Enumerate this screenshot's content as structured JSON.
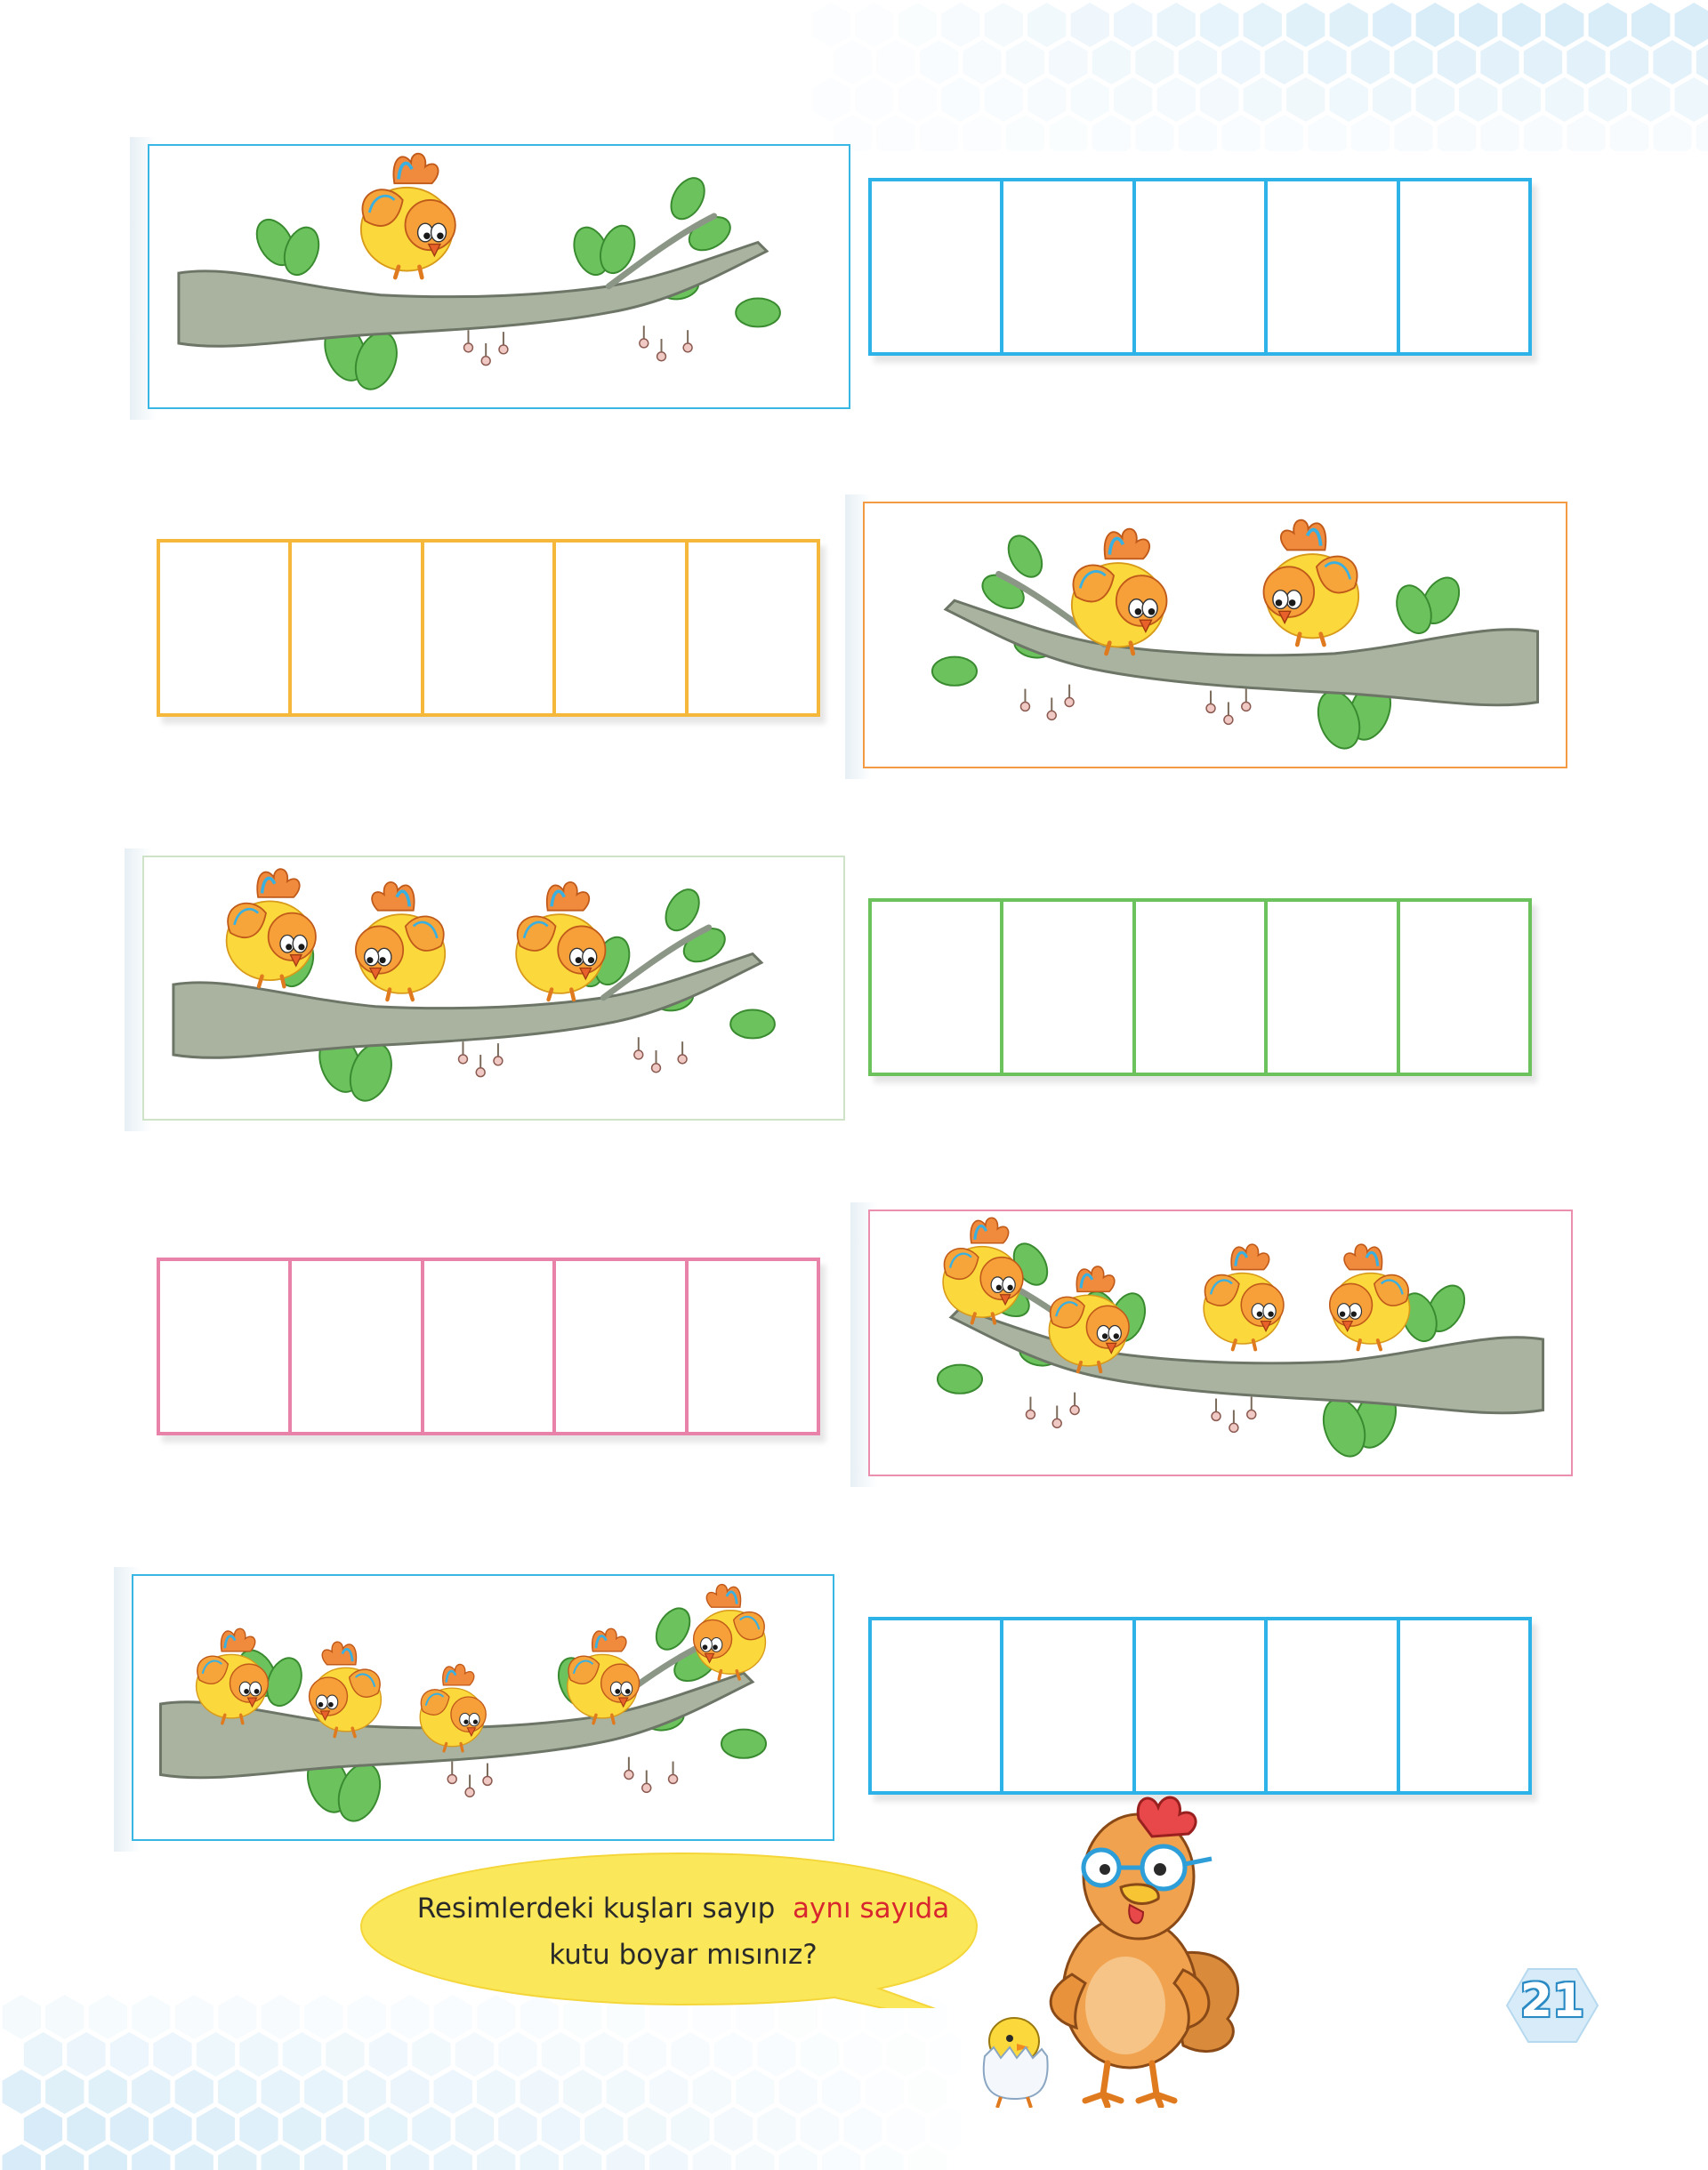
{
  "exercise": {
    "rows": [
      {
        "bird_count": 1,
        "box_count": 5,
        "frame_color": "#38b6e4",
        "box_color": "#2eb3e8"
      },
      {
        "bird_count": 2,
        "box_count": 5,
        "frame_color": "#f39a45",
        "box_color": "#f5b83a"
      },
      {
        "bird_count": 3,
        "box_count": 5,
        "frame_color": "#cfe3c8",
        "box_color": "#6cc35e"
      },
      {
        "bird_count": 4,
        "box_count": 5,
        "frame_color": "#ec8fae",
        "box_color": "#e882a8"
      },
      {
        "bird_count": 5,
        "box_count": 5,
        "frame_color": "#38b6e4",
        "box_color": "#2eb3e8"
      }
    ]
  },
  "instruction": {
    "part1": "Resimlerdeki kuşları sayıp",
    "highlight": "aynı sayıda",
    "part2": "kutu boyar mısınız?",
    "highlight_color": "#d8262f",
    "bubble_color": "#fbe85a"
  },
  "page_number": "21",
  "decorations": {
    "background_pattern": "hexagon-pattern",
    "bird_icon": "yellow-bird-icon",
    "branch_icon": "tree-branch-icon",
    "hen_icon": "hen-teacher-icon",
    "chick_icon": "chick-in-egg-icon",
    "hex_color": "#d7ecf8"
  }
}
